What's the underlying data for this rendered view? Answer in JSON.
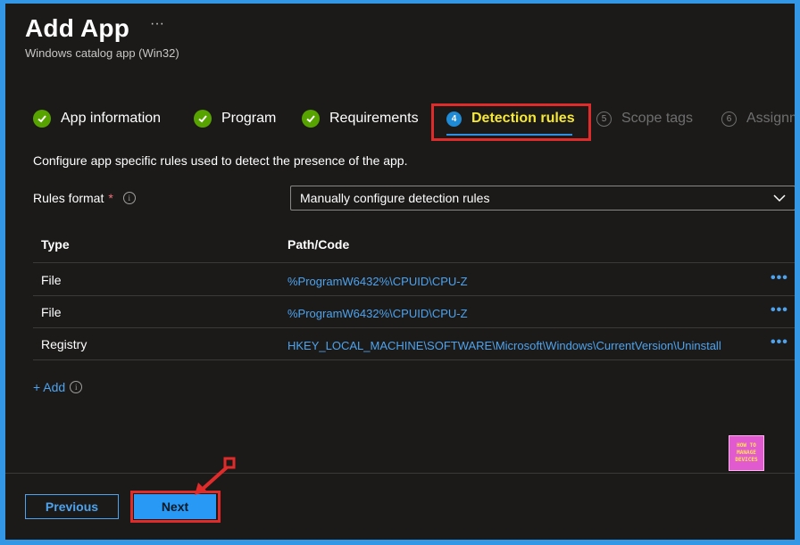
{
  "header": {
    "title": "Add App",
    "more": "···",
    "subtitle": "Windows catalog app (Win32)"
  },
  "steps": [
    {
      "label": "App information",
      "state": "done"
    },
    {
      "label": "Program",
      "state": "done"
    },
    {
      "label": "Requirements",
      "state": "done"
    },
    {
      "number": "4",
      "label": "Detection rules",
      "state": "active"
    },
    {
      "number": "5",
      "label": "Scope tags",
      "state": "disabled"
    },
    {
      "number": "6",
      "label": "Assignm",
      "state": "disabled"
    }
  ],
  "description": "Configure app specific rules used to detect the presence of the app.",
  "rules_format": {
    "label": "Rules format",
    "required": "*",
    "info": "i",
    "value": "Manually configure detection rules"
  },
  "table": {
    "headers": [
      "Type",
      "Path/Code"
    ],
    "rows": [
      {
        "type": "File",
        "path": "%ProgramW6432%\\CPUID\\CPU-Z",
        "more": "•••"
      },
      {
        "type": "File",
        "path": "%ProgramW6432%\\CPUID\\CPU-Z",
        "more": "•••"
      },
      {
        "type": "Registry",
        "path": "HKEY_LOCAL_MACHINE\\SOFTWARE\\Microsoft\\Windows\\CurrentVersion\\Uninstall",
        "more": "•••"
      }
    ]
  },
  "add_link": {
    "label": "+ Add",
    "info": "i"
  },
  "footer": {
    "previous": "Previous",
    "next": "Next"
  },
  "logo": {
    "line1": "HOW TO",
    "line2": "MANAGE",
    "line3": "DEVICES"
  },
  "colors": {
    "accent": "#2899f5",
    "link": "#4da3ee",
    "success": "#57a300",
    "highlight": "#e02b2b",
    "active_step": "#f6e833"
  }
}
